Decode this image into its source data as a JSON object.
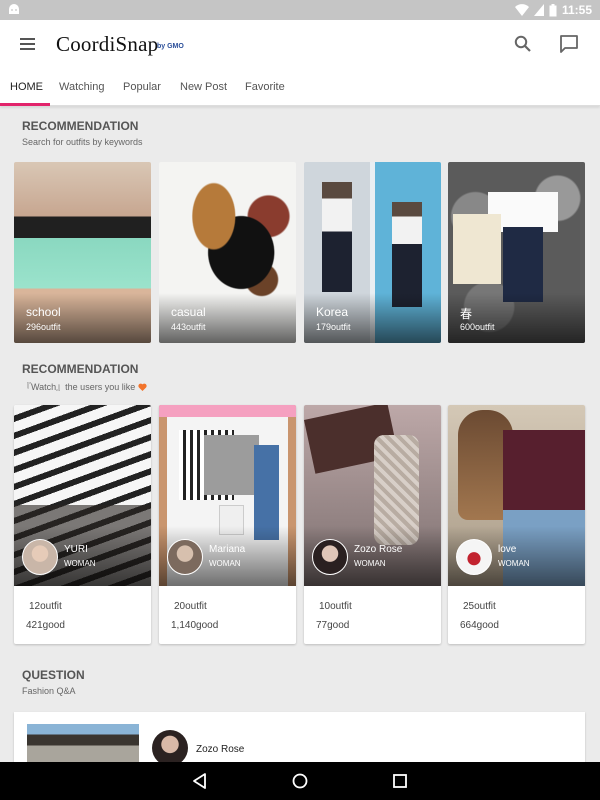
{
  "status_bar": {
    "time": "11:55",
    "icons": [
      "android-icon",
      "wifi-icon",
      "signal-icon",
      "battery-icon"
    ]
  },
  "app": {
    "logo": "CoordiSnap",
    "logo_sub": "by GMO"
  },
  "tabs": [
    {
      "label": "HOME",
      "active": true
    },
    {
      "label": "Watching",
      "active": false
    },
    {
      "label": "Popular",
      "active": false
    },
    {
      "label": "New Post",
      "active": false
    },
    {
      "label": "Favorite",
      "active": false
    }
  ],
  "accent_color": "#e2246b",
  "section1": {
    "title": "RECOMMENDATION",
    "subtitle": "Search for outfits by keywords",
    "categories": [
      {
        "name": "school",
        "count": "296outfit"
      },
      {
        "name": "casual",
        "count": "443outfit"
      },
      {
        "name": "Korea",
        "count": "179outfit"
      },
      {
        "name": "春",
        "count": "600outfit"
      }
    ]
  },
  "section2": {
    "title": "RECOMMENDATION",
    "subtitle_prefix": "『Watch』the users you like",
    "users": [
      {
        "name": "YURI",
        "gender": "WOMAN",
        "outfits": "12outfit",
        "goods": "421good"
      },
      {
        "name": "Mariana",
        "gender": "WOMAN",
        "outfits": "20outfit",
        "goods": "1,140good"
      },
      {
        "name": "Zozo Rose",
        "gender": "WOMAN",
        "outfits": "10outfit",
        "goods": "77good"
      },
      {
        "name": "love",
        "gender": "WOMAN",
        "outfits": "25outfit",
        "goods": "664good"
      }
    ]
  },
  "section3": {
    "title": "QUESTION",
    "subtitle": "Fashion Q&A",
    "question": {
      "user": "Zozo Rose"
    }
  }
}
